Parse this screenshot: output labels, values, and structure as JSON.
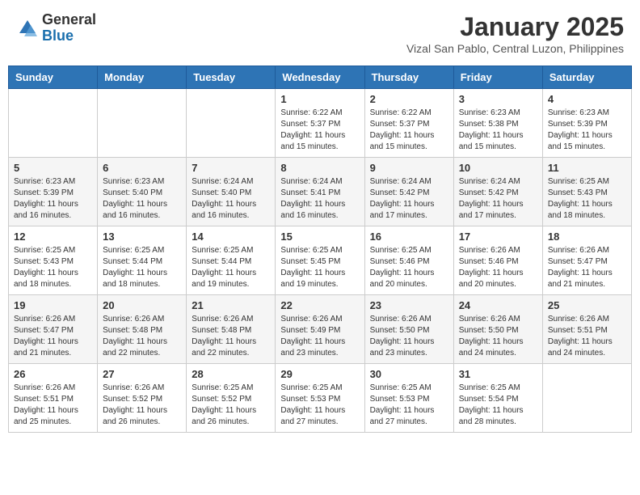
{
  "header": {
    "logo_general": "General",
    "logo_blue": "Blue",
    "month_title": "January 2025",
    "subtitle": "Vizal San Pablo, Central Luzon, Philippines"
  },
  "weekdays": [
    "Sunday",
    "Monday",
    "Tuesday",
    "Wednesday",
    "Thursday",
    "Friday",
    "Saturday"
  ],
  "weeks": [
    [
      {
        "day": "",
        "sunrise": "",
        "sunset": "",
        "daylight": ""
      },
      {
        "day": "",
        "sunrise": "",
        "sunset": "",
        "daylight": ""
      },
      {
        "day": "",
        "sunrise": "",
        "sunset": "",
        "daylight": ""
      },
      {
        "day": "1",
        "sunrise": "Sunrise: 6:22 AM",
        "sunset": "Sunset: 5:37 PM",
        "daylight": "Daylight: 11 hours and 15 minutes."
      },
      {
        "day": "2",
        "sunrise": "Sunrise: 6:22 AM",
        "sunset": "Sunset: 5:37 PM",
        "daylight": "Daylight: 11 hours and 15 minutes."
      },
      {
        "day": "3",
        "sunrise": "Sunrise: 6:23 AM",
        "sunset": "Sunset: 5:38 PM",
        "daylight": "Daylight: 11 hours and 15 minutes."
      },
      {
        "day": "4",
        "sunrise": "Sunrise: 6:23 AM",
        "sunset": "Sunset: 5:39 PM",
        "daylight": "Daylight: 11 hours and 15 minutes."
      }
    ],
    [
      {
        "day": "5",
        "sunrise": "Sunrise: 6:23 AM",
        "sunset": "Sunset: 5:39 PM",
        "daylight": "Daylight: 11 hours and 16 minutes."
      },
      {
        "day": "6",
        "sunrise": "Sunrise: 6:23 AM",
        "sunset": "Sunset: 5:40 PM",
        "daylight": "Daylight: 11 hours and 16 minutes."
      },
      {
        "day": "7",
        "sunrise": "Sunrise: 6:24 AM",
        "sunset": "Sunset: 5:40 PM",
        "daylight": "Daylight: 11 hours and 16 minutes."
      },
      {
        "day": "8",
        "sunrise": "Sunrise: 6:24 AM",
        "sunset": "Sunset: 5:41 PM",
        "daylight": "Daylight: 11 hours and 16 minutes."
      },
      {
        "day": "9",
        "sunrise": "Sunrise: 6:24 AM",
        "sunset": "Sunset: 5:42 PM",
        "daylight": "Daylight: 11 hours and 17 minutes."
      },
      {
        "day": "10",
        "sunrise": "Sunrise: 6:24 AM",
        "sunset": "Sunset: 5:42 PM",
        "daylight": "Daylight: 11 hours and 17 minutes."
      },
      {
        "day": "11",
        "sunrise": "Sunrise: 6:25 AM",
        "sunset": "Sunset: 5:43 PM",
        "daylight": "Daylight: 11 hours and 18 minutes."
      }
    ],
    [
      {
        "day": "12",
        "sunrise": "Sunrise: 6:25 AM",
        "sunset": "Sunset: 5:43 PM",
        "daylight": "Daylight: 11 hours and 18 minutes."
      },
      {
        "day": "13",
        "sunrise": "Sunrise: 6:25 AM",
        "sunset": "Sunset: 5:44 PM",
        "daylight": "Daylight: 11 hours and 18 minutes."
      },
      {
        "day": "14",
        "sunrise": "Sunrise: 6:25 AM",
        "sunset": "Sunset: 5:44 PM",
        "daylight": "Daylight: 11 hours and 19 minutes."
      },
      {
        "day": "15",
        "sunrise": "Sunrise: 6:25 AM",
        "sunset": "Sunset: 5:45 PM",
        "daylight": "Daylight: 11 hours and 19 minutes."
      },
      {
        "day": "16",
        "sunrise": "Sunrise: 6:25 AM",
        "sunset": "Sunset: 5:46 PM",
        "daylight": "Daylight: 11 hours and 20 minutes."
      },
      {
        "day": "17",
        "sunrise": "Sunrise: 6:26 AM",
        "sunset": "Sunset: 5:46 PM",
        "daylight": "Daylight: 11 hours and 20 minutes."
      },
      {
        "day": "18",
        "sunrise": "Sunrise: 6:26 AM",
        "sunset": "Sunset: 5:47 PM",
        "daylight": "Daylight: 11 hours and 21 minutes."
      }
    ],
    [
      {
        "day": "19",
        "sunrise": "Sunrise: 6:26 AM",
        "sunset": "Sunset: 5:47 PM",
        "daylight": "Daylight: 11 hours and 21 minutes."
      },
      {
        "day": "20",
        "sunrise": "Sunrise: 6:26 AM",
        "sunset": "Sunset: 5:48 PM",
        "daylight": "Daylight: 11 hours and 22 minutes."
      },
      {
        "day": "21",
        "sunrise": "Sunrise: 6:26 AM",
        "sunset": "Sunset: 5:48 PM",
        "daylight": "Daylight: 11 hours and 22 minutes."
      },
      {
        "day": "22",
        "sunrise": "Sunrise: 6:26 AM",
        "sunset": "Sunset: 5:49 PM",
        "daylight": "Daylight: 11 hours and 23 minutes."
      },
      {
        "day": "23",
        "sunrise": "Sunrise: 6:26 AM",
        "sunset": "Sunset: 5:50 PM",
        "daylight": "Daylight: 11 hours and 23 minutes."
      },
      {
        "day": "24",
        "sunrise": "Sunrise: 6:26 AM",
        "sunset": "Sunset: 5:50 PM",
        "daylight": "Daylight: 11 hours and 24 minutes."
      },
      {
        "day": "25",
        "sunrise": "Sunrise: 6:26 AM",
        "sunset": "Sunset: 5:51 PM",
        "daylight": "Daylight: 11 hours and 24 minutes."
      }
    ],
    [
      {
        "day": "26",
        "sunrise": "Sunrise: 6:26 AM",
        "sunset": "Sunset: 5:51 PM",
        "daylight": "Daylight: 11 hours and 25 minutes."
      },
      {
        "day": "27",
        "sunrise": "Sunrise: 6:26 AM",
        "sunset": "Sunset: 5:52 PM",
        "daylight": "Daylight: 11 hours and 26 minutes."
      },
      {
        "day": "28",
        "sunrise": "Sunrise: 6:25 AM",
        "sunset": "Sunset: 5:52 PM",
        "daylight": "Daylight: 11 hours and 26 minutes."
      },
      {
        "day": "29",
        "sunrise": "Sunrise: 6:25 AM",
        "sunset": "Sunset: 5:53 PM",
        "daylight": "Daylight: 11 hours and 27 minutes."
      },
      {
        "day": "30",
        "sunrise": "Sunrise: 6:25 AM",
        "sunset": "Sunset: 5:53 PM",
        "daylight": "Daylight: 11 hours and 27 minutes."
      },
      {
        "day": "31",
        "sunrise": "Sunrise: 6:25 AM",
        "sunset": "Sunset: 5:54 PM",
        "daylight": "Daylight: 11 hours and 28 minutes."
      },
      {
        "day": "",
        "sunrise": "",
        "sunset": "",
        "daylight": ""
      }
    ]
  ]
}
